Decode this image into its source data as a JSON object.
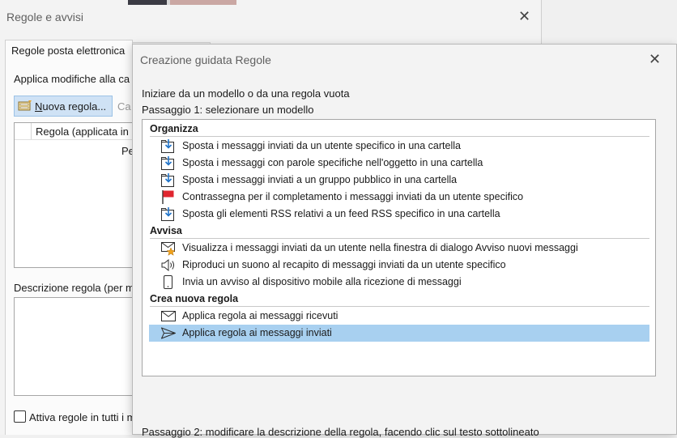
{
  "back_dialog": {
    "title": "Regole e avvisi",
    "close_glyph": "✕",
    "tab_email": "Regole posta elettronica",
    "apply_label": "Applica modifiche alla ca",
    "new_rule_prefix": "N",
    "new_rule_rest": "uova regola...",
    "change_label": "Ca",
    "list_header": "Regola (applicata in l",
    "list_row": "Pe",
    "desc_label": "Descrizione regola (per m",
    "enable_label": "Attiva regole in tutti i m"
  },
  "wizard": {
    "title": "Creazione guidata Regole",
    "close_glyph": "✕",
    "intro": "Iniziare da un modello o da una regola vuota",
    "step1": "Passaggio 1: selezionare un modello",
    "groups": {
      "organize": "Organizza",
      "notify": "Avvisa",
      "new_rule": "Crea nuova regola"
    },
    "items": [
      {
        "label": "Sposta i messaggi inviati da un utente specifico in una cartella",
        "icon": "folder-move-icon"
      },
      {
        "label": "Sposta i messaggi con parole specifiche nell'oggetto in una cartella",
        "icon": "folder-move-icon"
      },
      {
        "label": "Sposta i messaggi inviati a un gruppo pubblico in una cartella",
        "icon": "folder-move-icon"
      },
      {
        "label": "Contrassegna per il completamento i messaggi inviati da un utente specifico",
        "icon": "flag-icon"
      },
      {
        "label": "Sposta gli elementi RSS relativi a un feed RSS specifico in una cartella",
        "icon": "folder-move-icon"
      },
      {
        "label": "Visualizza i messaggi inviati da un utente nella finestra di dialogo Avviso nuovi messaggi",
        "icon": "mail-star-icon"
      },
      {
        "label": "Riproduci un suono al recapito di messaggi inviati da un utente specifico",
        "icon": "speaker-icon"
      },
      {
        "label": "Invia un avviso al dispositivo mobile alla ricezione di messaggi",
        "icon": "mobile-icon"
      },
      {
        "label": "Applica regola ai messaggi ricevuti",
        "icon": "envelope-icon"
      },
      {
        "label": "Applica regola ai messaggi inviati",
        "icon": "send-icon"
      }
    ],
    "selected_item": "Applica regola ai messaggi inviati",
    "step2": "Passaggio 2: modificare la descrizione della regola, facendo clic sul testo sottolineato"
  },
  "colors": {
    "selection": "#a8d0f0",
    "flag": "#e0262f",
    "icon_blue": "#1f73c9"
  }
}
